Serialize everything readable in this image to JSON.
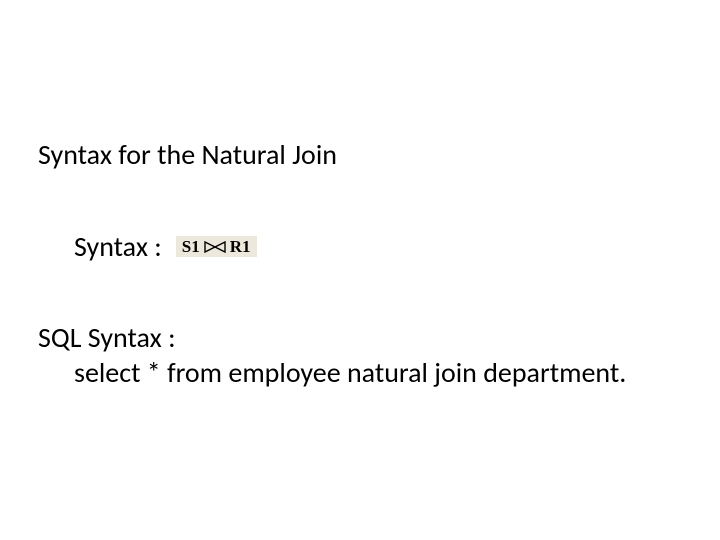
{
  "heading": "Syntax for the Natural Join",
  "syntax_label": "Syntax :",
  "relation": {
    "left": "S1",
    "right": "R1"
  },
  "sql": {
    "label": "SQL Syntax :",
    "code": "select * from employee natural join department."
  }
}
